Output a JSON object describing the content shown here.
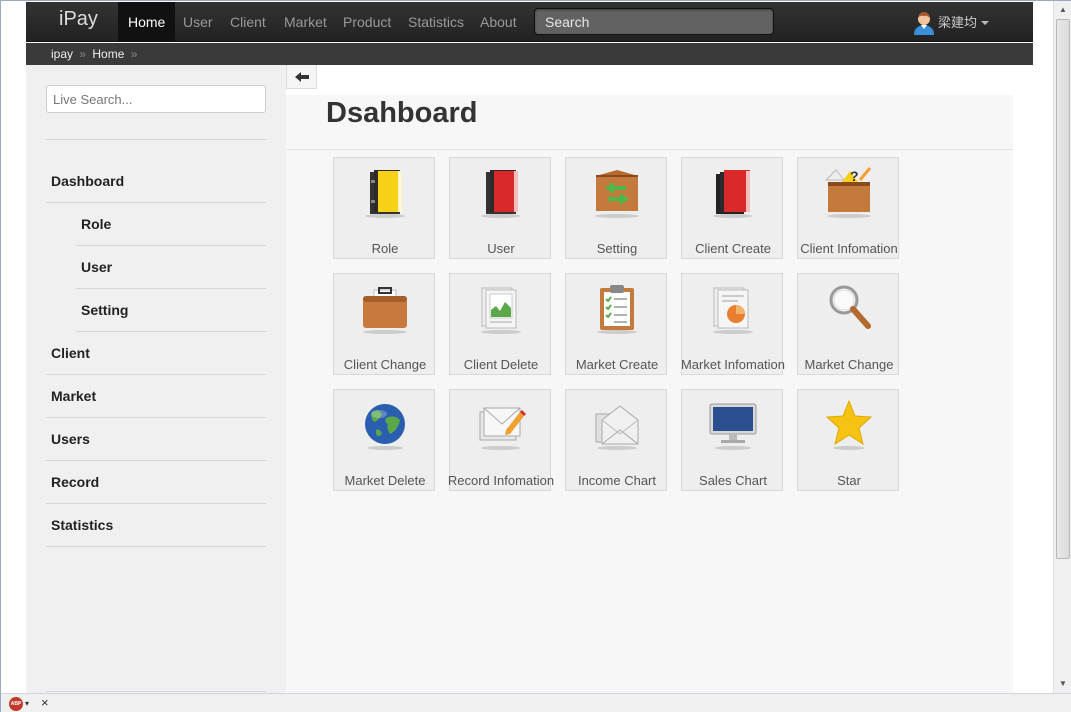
{
  "navbar": {
    "brand": "iPay",
    "items": [
      {
        "label": "Home",
        "active": true
      },
      {
        "label": "User"
      },
      {
        "label": "Client"
      },
      {
        "label": "Market"
      },
      {
        "label": "Product"
      },
      {
        "label": "Statistics"
      },
      {
        "label": "About"
      }
    ],
    "search_placeholder": "Search",
    "user_name": "梁建均"
  },
  "breadcrumb": {
    "items": [
      "ipay",
      "Home"
    ],
    "separator": "»"
  },
  "sidebar": {
    "search_placeholder": "Live Search...",
    "items": [
      {
        "label": "Dashboard"
      },
      {
        "label": "Role"
      },
      {
        "label": "User"
      },
      {
        "label": "Setting"
      },
      {
        "label": "Client"
      },
      {
        "label": "Market"
      },
      {
        "label": "Users"
      },
      {
        "label": "Record"
      },
      {
        "label": "Statistics"
      }
    ]
  },
  "main": {
    "title": "Dsahboard",
    "tiles": [
      {
        "label": "Role",
        "icon": "yellow-book-icon"
      },
      {
        "label": "User",
        "icon": "red-book-icon"
      },
      {
        "label": "Setting",
        "icon": "box-arrows-icon"
      },
      {
        "label": "Client Create",
        "icon": "red-books-icon"
      },
      {
        "label": "Client Infomation",
        "icon": "crate-question-icon"
      },
      {
        "label": "Client Change",
        "icon": "briefcase-icon"
      },
      {
        "label": "Client Delete",
        "icon": "chart-document-icon"
      },
      {
        "label": "Market Create",
        "icon": "clipboard-icon"
      },
      {
        "label": "Market Infomation",
        "icon": "pie-document-icon"
      },
      {
        "label": "Market Change",
        "icon": "magnifier-icon"
      },
      {
        "label": "Market Delete",
        "icon": "globe-icon"
      },
      {
        "label": "Record Infomation",
        "icon": "mail-pencil-icon"
      },
      {
        "label": "Income Chart",
        "icon": "envelope-icon"
      },
      {
        "label": "Sales Chart",
        "icon": "monitor-icon"
      },
      {
        "label": "Star",
        "icon": "star-icon"
      }
    ]
  },
  "statusbar": {
    "abp_label": "ABP",
    "close_label": "×"
  },
  "colors": {
    "navbar_bg": "#222222",
    "active_nav": "#111111",
    "sidebar_bg": "#f0f0f0",
    "tile_bg": "#eeeeee"
  }
}
